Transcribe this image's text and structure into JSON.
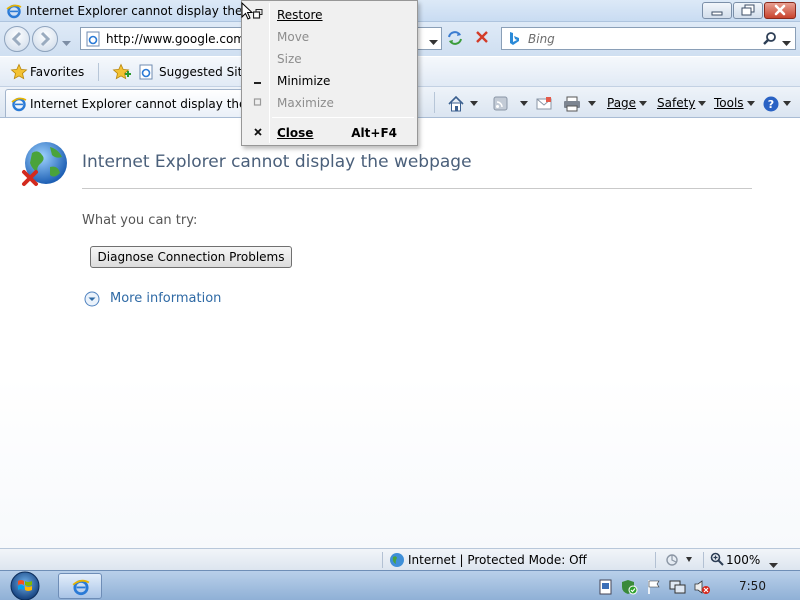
{
  "window": {
    "title": "Internet Explorer cannot display the webpage"
  },
  "address_bar": {
    "url": "http://www.google.com/",
    "search_placeholder": "Bing"
  },
  "favorites_bar": {
    "favorites_label": "Favorites",
    "suggested_sites_label": "Suggested Sites"
  },
  "tab": {
    "title": "Internet Explorer cannot display the webpage"
  },
  "command_bar": {
    "page_label": "Page",
    "safety_label": "Safety",
    "tools_label": "Tools"
  },
  "content": {
    "heading": "Internet Explorer cannot display the webpage",
    "try_label": "What you can try:",
    "diagnose_button": "Diagnose Connection Problems",
    "more_info": "More information"
  },
  "status_bar": {
    "zone": "Internet | Protected Mode: Off",
    "zoom": "100%"
  },
  "taskbar": {
    "clock": "7:50"
  },
  "system_menu": {
    "items": [
      {
        "label": "Restore",
        "icon": "restore-glyph",
        "enabled": true
      },
      {
        "label": "Move",
        "enabled": false
      },
      {
        "label": "Size",
        "enabled": false
      },
      {
        "label": "Minimize",
        "icon": "minimize-glyph",
        "enabled": true
      },
      {
        "label": "Maximize",
        "icon": "maximize-glyph",
        "enabled": false
      },
      {
        "label": "Close",
        "icon": "close-glyph",
        "enabled": true,
        "shortcut": "Alt+F4"
      }
    ]
  },
  "colors": {
    "heading": "#4a5f7a",
    "link": "#2f6aa5",
    "chrome": "#dce9f7",
    "disabled_text": "#8d8d8d"
  }
}
